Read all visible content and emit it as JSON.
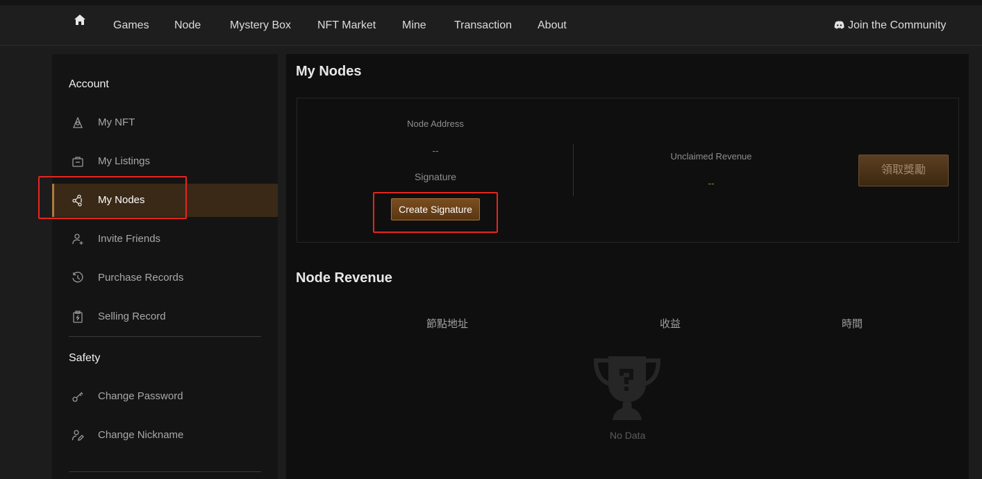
{
  "nav": {
    "items": [
      "Games",
      "Node",
      "Mystery Box",
      "NFT Market",
      "Mine",
      "Transaction",
      "About"
    ],
    "community": "Join the Community",
    "home_icon": "home-icon",
    "community_icon": "discord-icon"
  },
  "sidebar": {
    "account_heading": "Account",
    "safety_heading": "Safety",
    "account_items": [
      {
        "label": "My NFT",
        "icon": "nft-icon"
      },
      {
        "label": "My Listings",
        "icon": "listings-icon"
      },
      {
        "label": "My Nodes",
        "icon": "nodes-icon",
        "active": true
      },
      {
        "label": "Invite Friends",
        "icon": "invite-icon"
      },
      {
        "label": "Purchase Records",
        "icon": "history-icon"
      },
      {
        "label": "Selling Record",
        "icon": "clipboard-icon"
      }
    ],
    "safety_items": [
      {
        "label": "Change Password",
        "icon": "key-icon"
      },
      {
        "label": "Change Nickname",
        "icon": "user-edit-icon"
      }
    ]
  },
  "main": {
    "title": "My Nodes",
    "node_address_label": "Node Address",
    "node_address_value": "--",
    "signature_label": "Signature",
    "create_signature_button": "Create Signature",
    "unclaimed_label": "Unclaimed Revenue",
    "unclaimed_value": "--",
    "claim_button": "領取獎勵",
    "revenue_title": "Node Revenue",
    "columns": [
      "節點地址",
      "收益",
      "時間"
    ],
    "empty_text": "No Data"
  },
  "colors": {
    "accent": "#b07a3c",
    "highlight": "#e8251f",
    "active_bg": "#3a2917"
  }
}
